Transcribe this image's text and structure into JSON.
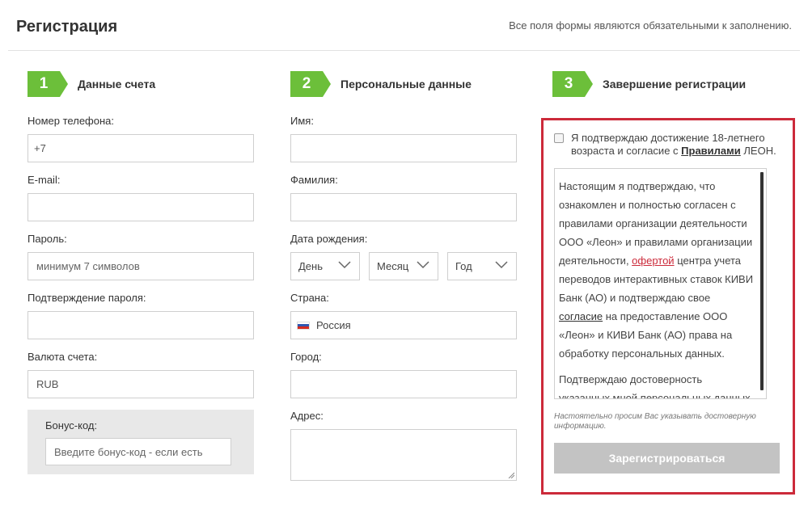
{
  "header": {
    "title": "Регистрация",
    "required_note": "Все поля формы являются обязательными к заполнению."
  },
  "steps": [
    {
      "number": "1",
      "title": "Данные счета"
    },
    {
      "number": "2",
      "title": "Персональные данные"
    },
    {
      "number": "3",
      "title": "Завершение регистрации"
    }
  ],
  "account": {
    "phone_label": "Номер телефона:",
    "phone_value": "+7",
    "email_label": "E-mail:",
    "email_value": "",
    "password_label": "Пароль:",
    "password_placeholder": "минимум 7 символов",
    "password_confirm_label": "Подтверждение пароля:",
    "password_confirm_value": "",
    "currency_label": "Валюта счета:",
    "currency_value": "RUB",
    "bonus_label": "Бонус-код:",
    "bonus_placeholder": "Введите бонус-код - если есть"
  },
  "personal": {
    "first_name_label": "Имя:",
    "first_name_value": "",
    "last_name_label": "Фамилия:",
    "last_name_value": "",
    "dob_label": "Дата рождения:",
    "dob_day": "День",
    "dob_month": "Месяц",
    "dob_year": "Год",
    "country_label": "Страна:",
    "country_value": "Россия",
    "city_label": "Город:",
    "city_value": "",
    "address_label": "Адрес:",
    "address_value": ""
  },
  "completion": {
    "confirm_text_1": "Я подтверждаю достижение 18-летнего возраста и согласие с ",
    "confirm_link": "Правилами",
    "confirm_text_2": " ЛЕОН.",
    "terms_p1_a": "Настоящим я подтверждаю, что ознакомлен и полностью согласен с правилами организации деятельности ООО «Леон» и правилами организации деятельности, ",
    "terms_offer_link": "офертой",
    "terms_p1_b": " центра учета переводов интерактивных ставок КИВИ Банк (АО) и подтверждаю свое ",
    "terms_agree_link": "согласие",
    "terms_p1_c": " на предоставление ООО «Леон» и КИВИ Банк (АО) права на обработку персональных данных.",
    "terms_p2": "Подтверждаю достоверность указанных мной персональных данных",
    "hint": "Настоятельно просим Вас указывать достоверную информацию.",
    "register_button": "Зарегистрироваться"
  },
  "colors": {
    "accent_green": "#6cbf3a",
    "highlight_red": "#cc2a3a",
    "button_disabled": "#c3c3c3"
  }
}
